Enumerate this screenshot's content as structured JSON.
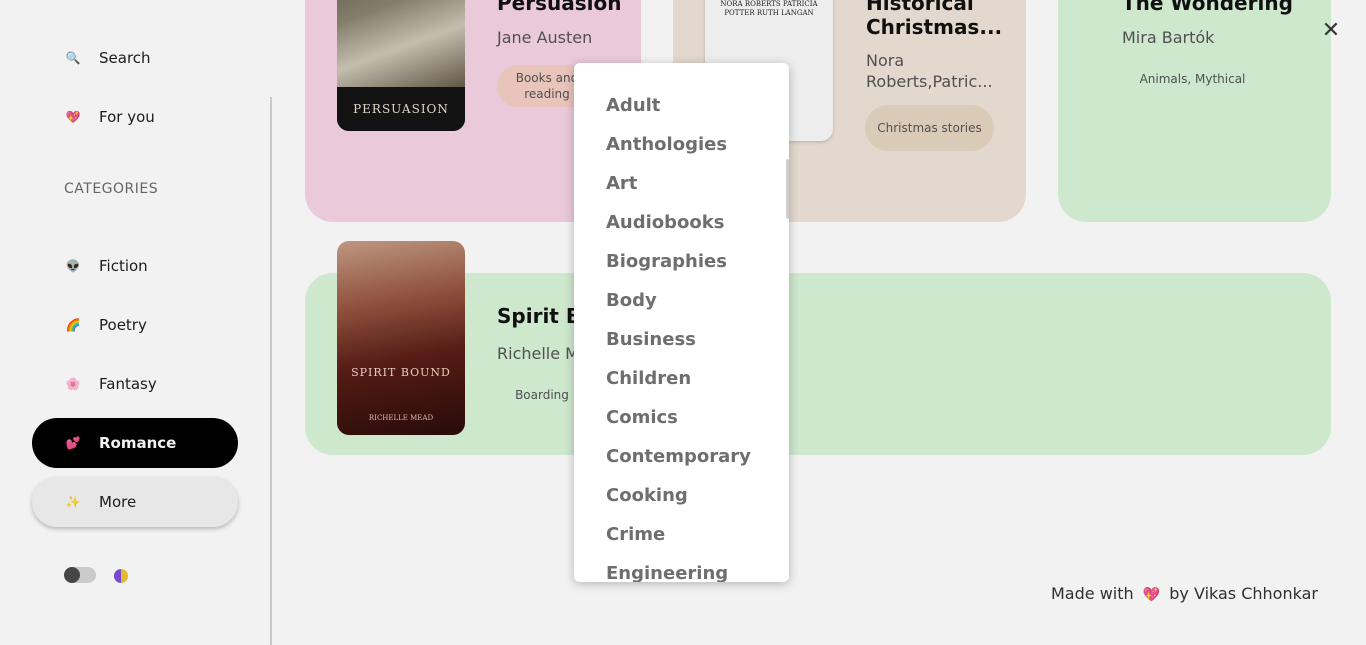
{
  "sidebar": {
    "items": [
      {
        "label": "Search",
        "icon": "🔍",
        "icon_name": "search-icon"
      },
      {
        "label": "For you",
        "icon": "💖",
        "icon_name": "heart-icon"
      }
    ],
    "categories_heading": "CATEGORIES",
    "categories": [
      {
        "label": "Fiction",
        "icon": "👽",
        "icon_name": "alien-icon"
      },
      {
        "label": "Poetry",
        "icon": "🌈",
        "icon_name": "rainbow-icon"
      },
      {
        "label": "Fantasy",
        "icon": "🌸",
        "icon_name": "flower-icon"
      },
      {
        "label": "Romance",
        "icon": "💕",
        "icon_name": "two-hearts-icon",
        "active": true
      },
      {
        "label": "More",
        "icon": "✨",
        "icon_name": "sparkles-icon"
      }
    ]
  },
  "books": [
    {
      "title": "Persuasion",
      "author": "Jane Austen",
      "tag": "Books and reading",
      "cover_text": "PERSUASION"
    },
    {
      "title": "Historical Christmas...",
      "author": "Nora Roberts,Patric...",
      "tag": "Christmas stories",
      "cover_text": "NORA ROBERTS PATRICIA POTTER RUTH LANGAN"
    },
    {
      "title": "The Wondering",
      "author": "Mira Bartók",
      "tag": "Animals, Mythical"
    },
    {
      "title": "Spirit Bound",
      "author": "Richelle Mead",
      "tag": "Boarding",
      "cover_text": "SPIRIT BOUND",
      "cover_author": "RICHELLE MEAD"
    }
  ],
  "dropdown": {
    "options": [
      "Adult",
      "Anthologies",
      "Art",
      "Audiobooks",
      "Biographies",
      "Body",
      "Business",
      "Children",
      "Comics",
      "Contemporary",
      "Cooking",
      "Crime",
      "Engineering"
    ]
  },
  "footer": {
    "prefix": "Made with",
    "heart": "💖",
    "suffix": "by Vikas Chhonkar"
  },
  "close_symbol": "✕",
  "colors": {
    "active_nav": "#000000",
    "card_pink": "#f7d4e6",
    "card_beige": "#f0e4d8",
    "card_green": "#d9f5d9"
  }
}
